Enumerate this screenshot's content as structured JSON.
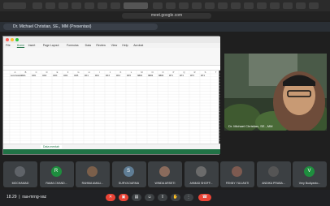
{
  "browser": {
    "url": "meet.google.com"
  },
  "meet": {
    "presenting_label": "Dr. Michael Christian, SE., MM (Presentasi)",
    "video_name": "Dr. Michael Christian, SE., MM",
    "time": "18.29",
    "meeting_code": "raa-mrng-vaz"
  },
  "excel": {
    "sheet_tab": "Data mentah",
    "ribbon_tabs": [
      "File",
      "Home",
      "Insert",
      "Page Layout",
      "Formulas",
      "Data",
      "Review",
      "View",
      "Help",
      "Acrobat"
    ],
    "columns": [
      "A",
      "B",
      "C",
      "D",
      "E",
      "F",
      "G",
      "H",
      "I",
      "J",
      "K",
      "L",
      "M",
      "N",
      "O",
      "P",
      "Q",
      "R",
      "S",
      "T"
    ],
    "headers": [
      "Jenis Kelamin",
      "USIA",
      "CIR1",
      "CIR2",
      "CIR3",
      "CIR4",
      "CIR5",
      "WF1",
      "WF2",
      "WF3",
      "WF4",
      "WF5",
      "NBR1",
      "NBR2",
      "NBR3",
      "WT1",
      "WT2",
      "WT3",
      "WT4"
    ]
  },
  "participants": [
    {
      "name": "MOCHAMAD",
      "initial": "",
      "color": "#5f6368"
    },
    {
      "name": "RAMA CHAND...",
      "initial": "R",
      "color": "#1e8e3e"
    },
    {
      "name": "RAHMA AMALI...",
      "initial": "",
      "color": "#7b5f4a"
    },
    {
      "name": "SURYA DARMA",
      "initial": "S",
      "color": "#5f7d95"
    },
    {
      "name": "WINDA ARSETI",
      "initial": "",
      "color": "#8a6b5c"
    },
    {
      "name": "AHMAD SHOFF...",
      "initial": "",
      "color": "#6b6b6b"
    },
    {
      "name": "FENNY YULIANTI",
      "initial": "",
      "color": "#7d5a50"
    },
    {
      "name": "ANDIKA PRABA...",
      "initial": "",
      "color": "#555"
    },
    {
      "name": "Very Budiyanto...",
      "initial": "V",
      "color": "#1e8e3e"
    }
  ]
}
